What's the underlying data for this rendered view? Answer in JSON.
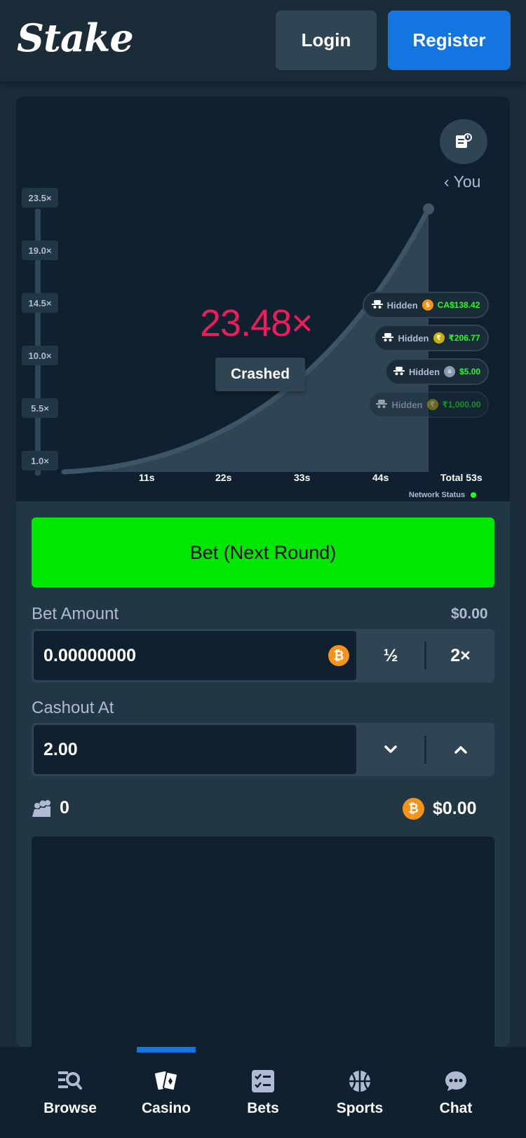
{
  "header": {
    "logo_text": "Stake",
    "login_label": "Login",
    "register_label": "Register"
  },
  "game": {
    "you_label": "You",
    "y_ticks": [
      "23.5×",
      "19.0×",
      "14.5×",
      "10.0×",
      "5.5×",
      "1.0×"
    ],
    "x_ticks": [
      "11s",
      "22s",
      "33s",
      "44s",
      "Total 53s"
    ],
    "multiplier": "23.48×",
    "status": "Crashed",
    "network_status": "Network Status",
    "players": [
      {
        "name": "Hidden",
        "coin": "usd-coin",
        "coin_color": "#f7931a",
        "amount": "CA$138.42"
      },
      {
        "name": "Hidden",
        "coin": "rupee-coin",
        "coin_color": "#c9b10a",
        "amount": "₹206.77"
      },
      {
        "name": "Hidden",
        "coin": "stable-coin",
        "coin_color": "#8b99b0",
        "amount": "$5.00"
      },
      {
        "name": "Hidden",
        "coin": "rupee-coin",
        "coin_color": "#c9b10a",
        "amount": "₹1,000.00"
      }
    ]
  },
  "controls": {
    "bet_button_label": "Bet (Next Round)",
    "bet_amount_label": "Bet Amount",
    "bet_amount_usd": "$0.00",
    "bet_amount_value": "0.00000000",
    "half_label": "½",
    "double_label": "2×",
    "cashout_label": "Cashout At",
    "cashout_value": "2.00",
    "players_count": "0",
    "total_wagered": "$0.00"
  },
  "nav": {
    "items": [
      {
        "label": "Browse"
      },
      {
        "label": "Casino"
      },
      {
        "label": "Bets"
      },
      {
        "label": "Sports"
      },
      {
        "label": "Chat"
      }
    ],
    "active": "Casino"
  },
  "colors": {
    "accent_green": "#00e701",
    "brand_blue": "#1475e1",
    "crash_red": "#ed1c5b"
  }
}
